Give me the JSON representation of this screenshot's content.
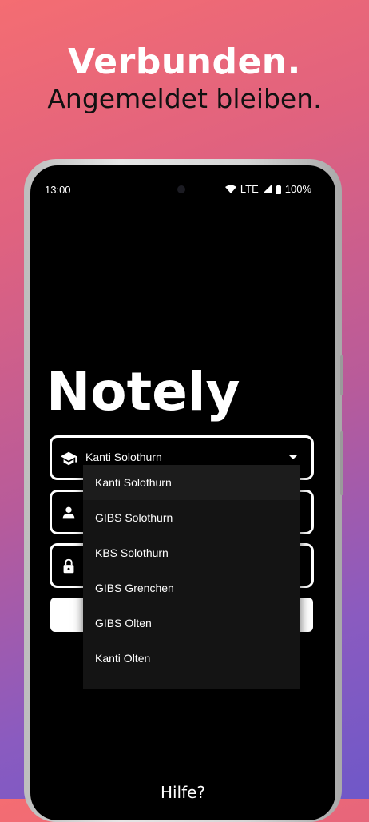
{
  "marketing": {
    "headline": "Verbunden.",
    "subline": "Angemeldet bleiben."
  },
  "status_bar": {
    "time": "13:00",
    "network": "LTE",
    "battery": "100%",
    "icons": [
      "wifi-icon",
      "signal-icon",
      "battery-icon"
    ]
  },
  "app": {
    "title": "Notely",
    "school_field": {
      "value": "Kanti Solothurn",
      "icon": "school-icon"
    },
    "username_field": {
      "icon": "person-icon"
    },
    "password_field": {
      "icon": "lock-icon"
    },
    "help_label": "Hilfe?"
  },
  "dropdown": {
    "selected": "Kanti Solothurn",
    "options": [
      "Kanti Solothurn",
      "GIBS Solothurn",
      "KBS Solothurn",
      "GIBS Grenchen",
      "GIBS Olten",
      "Kanti Olten"
    ]
  },
  "colors": {
    "screen_bg": "#000000",
    "menu_bg": "#141414",
    "accent": "#ffffff"
  }
}
